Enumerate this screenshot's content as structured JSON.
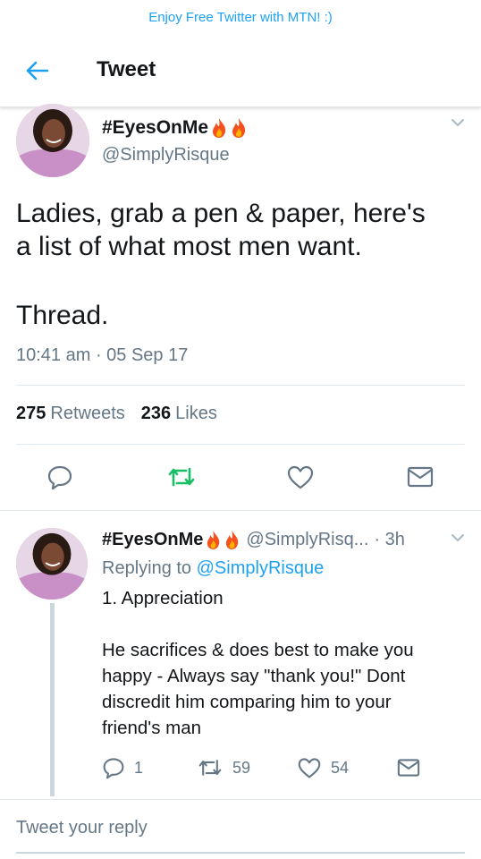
{
  "banner": {
    "text": "Enjoy Free Twitter with MTN! :)"
  },
  "appbar": {
    "title": "Tweet",
    "back_icon": "arrow-left-icon"
  },
  "main_tweet": {
    "display_name": "#EyesOnMe",
    "emoji_icons": [
      "fire-icon",
      "fire-icon"
    ],
    "handle": "@SimplyRisque",
    "text_lines": [
      "Ladies, grab a pen & paper, here's",
      "a list of what most men want."
    ],
    "text_line3": "Thread.",
    "timestamp": "10:41 am · 05 Sep 17",
    "retweets_count": "275",
    "retweets_label": "Retweets",
    "likes_count": "236",
    "likes_label": "Likes",
    "actions": [
      "reply-icon",
      "retweet-icon",
      "like-icon",
      "message-icon"
    ]
  },
  "reply": {
    "display_name": "#EyesOnMe",
    "handle": "@SimplyRisq...",
    "time": "· 3h",
    "replying_prefix": "Replying to",
    "replying_handle": "@SimplyRisque",
    "line1": "1. Appreciation",
    "line2": "He sacrifices & does best to make you",
    "line3": "happy - Always say \"thank you!\" Dont",
    "line4": "discredit him comparing him to your",
    "line5": "friend's man",
    "reply_count": "1",
    "retweet_count": "59",
    "like_count": "54"
  },
  "composer": {
    "placeholder": "Tweet your reply"
  },
  "colors": {
    "accent": "#1da1f2",
    "retweet_green": "#17bf63",
    "muted": "#657786",
    "text": "#14171a",
    "flame": "#f4511e"
  }
}
